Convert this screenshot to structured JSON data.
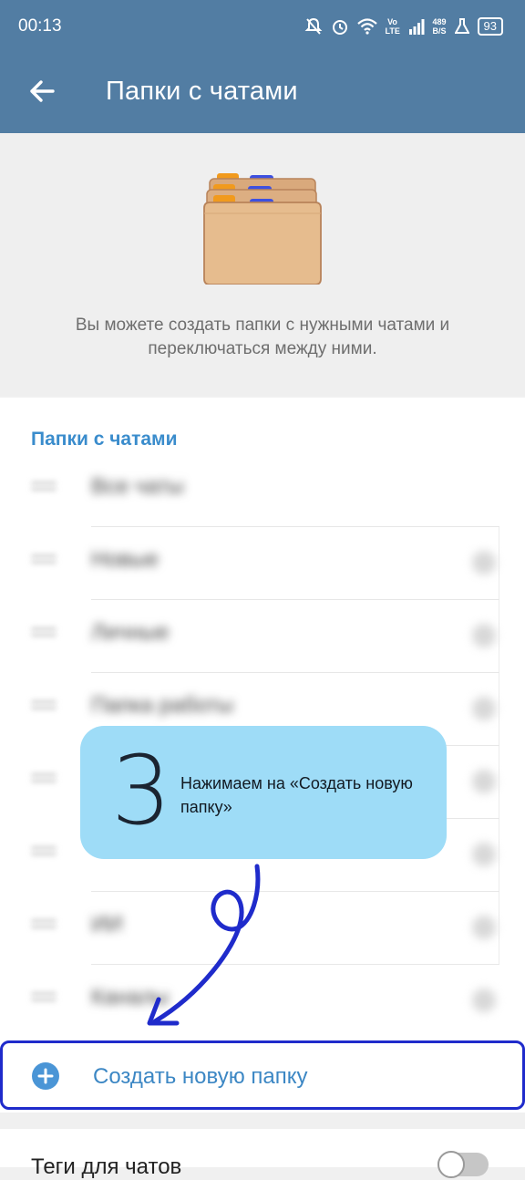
{
  "status_bar": {
    "time": "00:13",
    "volte": "Vo LTE",
    "speed_value": "489",
    "speed_unit": "B/S",
    "battery": "93"
  },
  "app_bar": {
    "back_icon": "arrow-left-icon",
    "title": "Папки с чатами"
  },
  "hero": {
    "illustration": "folders-icon",
    "description": "Вы можете создать папки с нужными чатами и переключаться между ними."
  },
  "folders_section": {
    "header": "Папки с чатами",
    "items": [
      {
        "label": "Все чаты"
      },
      {
        "label": "Новые"
      },
      {
        "label": "Личные"
      },
      {
        "label": "Папка работы"
      },
      {
        "label": ""
      },
      {
        "label": ""
      },
      {
        "label": "ИИ"
      },
      {
        "label": "Каналы"
      }
    ]
  },
  "create_button": {
    "icon": "plus-circle-icon",
    "label": "Создать новую папку"
  },
  "tags_row": {
    "label": "Теги для чатов",
    "toggle_on": false
  },
  "tutorial": {
    "step_number": "3",
    "text": "Нажимаем на «Создать новую папку»"
  },
  "colors": {
    "app_bar": "#527da3",
    "accent": "#3c87c4",
    "callout": "#9edcf7",
    "highlight": "#1f2bcb"
  }
}
